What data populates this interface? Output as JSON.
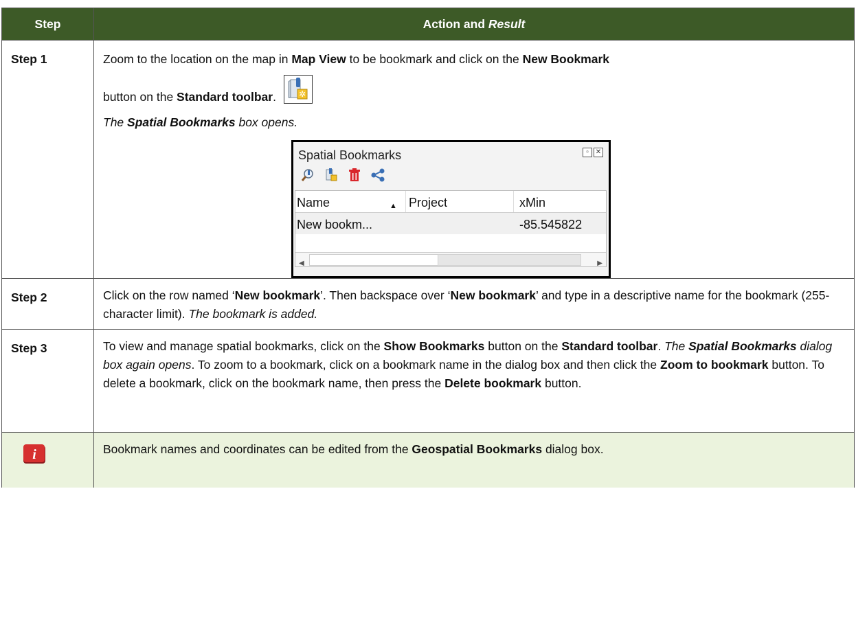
{
  "header": {
    "step": "Step",
    "action_a": "Action and ",
    "action_b": "Result"
  },
  "rows": [
    {
      "step": "Step 1",
      "l1a": "Zoom to the location on the map in ",
      "l1b": "Map View",
      "l1c": " to be bookmark and click on the ",
      "l1d": "New Bookmark",
      "l2a": "button on the ",
      "l2b": "Standard toolbar",
      "l2c": ".",
      "l3a": "The ",
      "l3b": "Spatial Bookmarks",
      "l3c": " box opens."
    },
    {
      "step": "Step 2",
      "a": "Click on the row named ‘",
      "b": "New bookmark",
      "c": "’. Then backspace over ‘",
      "d": "New bookmark",
      "e": "’ and type in a descriptive name for the bookmark (255-character limit). ",
      "f": "The bookmark is added."
    },
    {
      "step": "Step 3",
      "a": "To view and manage spatial bookmarks, click on the ",
      "b": "Show Bookmarks",
      "c": " button on the ",
      "d": "Standard toolbar",
      "e": ". ",
      "f1": "The ",
      "f2": "Spatial Bookmarks",
      "f3": " dialog box again opens",
      "g": ". To zoom to a bookmark, click on a bookmark name in the dialog box and then click the ",
      "h": "Zoom to bookmark",
      "i": " button. To delete a bookmark, click on the bookmark name, then press the ",
      "j": "Delete bookmark",
      "k": " button."
    }
  ],
  "note": {
    "a": "Bookmark names and coordinates can be edited from the ",
    "b": "Geospatial Bookmarks",
    "c": " dialog box."
  },
  "dialog": {
    "title": "Spatial Bookmarks",
    "columns": [
      "Name",
      "Project",
      "xMin"
    ],
    "row": {
      "name": "New bookm...",
      "project": "",
      "xmin": "-85.545822"
    }
  },
  "colors": {
    "header_bg": "#3d5a27",
    "note_bg": "#ebf3dd",
    "info_icon": "#c8262a"
  }
}
